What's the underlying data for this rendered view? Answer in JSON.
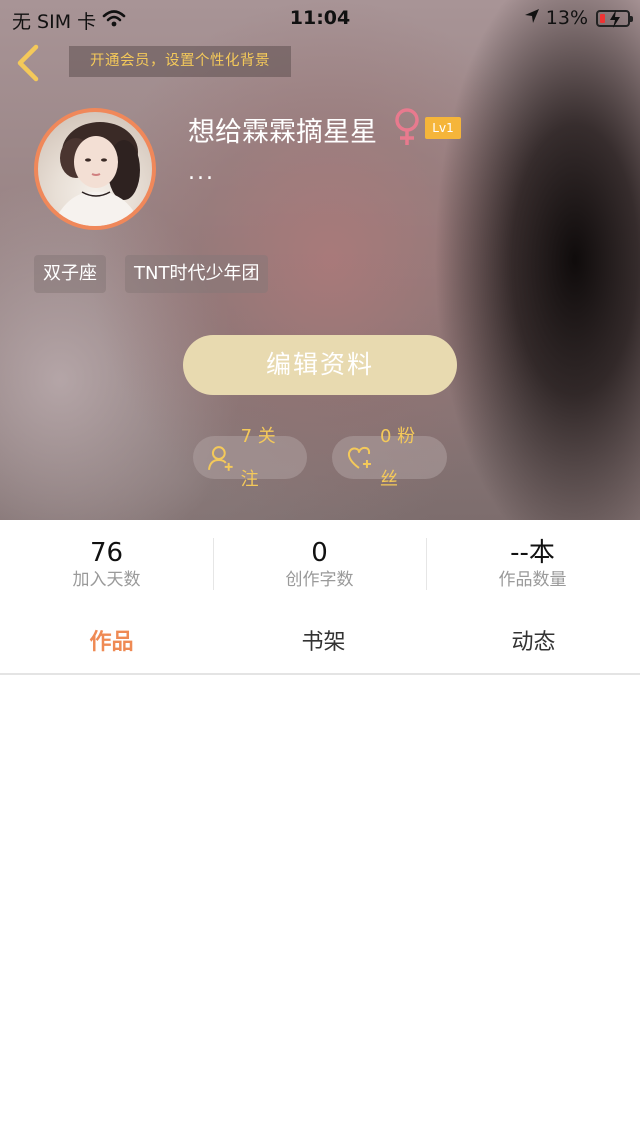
{
  "status_bar": {
    "carrier": "无 SIM 卡",
    "time": "11:04",
    "battery": "13%"
  },
  "header": {
    "vip_banner": "开通会员，设置个性化背景",
    "nickname": "想给霖霖摘星星",
    "level": "Lv1",
    "bio": "...",
    "tags": [
      "双子座",
      "TNT时代少年团"
    ],
    "edit_button": "编辑资料",
    "follow": "7 关注",
    "fans": "0 粉丝"
  },
  "stats": [
    {
      "value": "76",
      "label": "加入天数"
    },
    {
      "value": "0",
      "label": "创作字数"
    },
    {
      "value": "--本",
      "label": "作品数量"
    }
  ],
  "tabs": [
    {
      "label": "作品",
      "active": true
    },
    {
      "label": "书架",
      "active": false
    },
    {
      "label": "动态",
      "active": false
    }
  ],
  "colors": {
    "accent_orange": "#ef8a54",
    "gold": "#f4c95a",
    "level_badge": "#f5b53a",
    "edit_button_bg": "#e8dab0",
    "gender_pink": "#e87a8e"
  },
  "icons": [
    "back-chevron-icon",
    "wifi-icon",
    "location-arrow-icon",
    "battery-icon",
    "female-icon",
    "add-user-icon",
    "heart-plus-icon"
  ]
}
